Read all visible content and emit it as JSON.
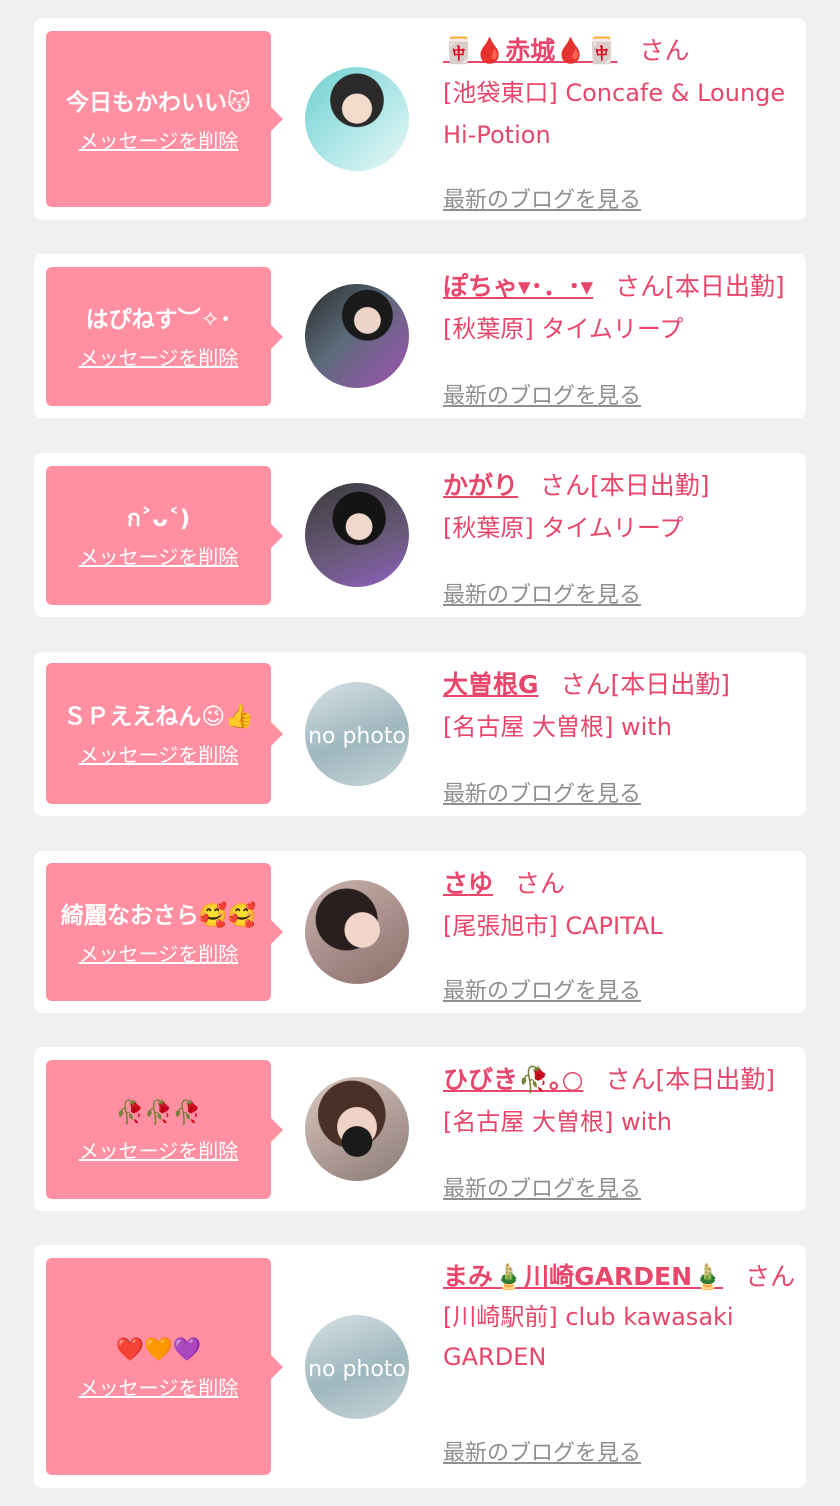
{
  "common": {
    "delete_label": "メッセージを削除",
    "blog_label": "最新のブログを見る",
    "no_photo": "no photo"
  },
  "items": [
    {
      "message": "今日もかわいい😽",
      "name": "🀄🩸赤城🩸🀄",
      "suffix": "さん",
      "shop": "[池袋東口] Concafe & Lounge Hi-Potion",
      "avatar": "photo"
    },
    {
      "message": "はぴねす︶✧･",
      "name": "ぽちゃ▾･．･▾",
      "suffix": "さん[本日出勤]",
      "shop": "[秋葉原] タイムリープ",
      "avatar": "photo"
    },
    {
      "message": "ก˃ᴗ˂)",
      "name": "かがり",
      "suffix": "さん[本日出勤]",
      "shop": "[秋葉原] タイムリープ",
      "avatar": "photo"
    },
    {
      "message": "ＳＰええねん😉👍",
      "name": "大曽根G",
      "suffix": "さん[本日出勤]",
      "shop": "[名古屋 大曽根] with",
      "avatar": "no-photo"
    },
    {
      "message": "綺麗なおさら🥰🥰",
      "name": "さゆ",
      "suffix": "さん",
      "shop": "[尾張旭市] CAPITAL",
      "avatar": "photo"
    },
    {
      "message": "🥀🥀🥀",
      "name": "ひびき🥀｡○",
      "suffix": "さん[本日出勤]",
      "shop": "[名古屋 大曽根] with",
      "avatar": "photo"
    },
    {
      "message": "❤️🧡💜",
      "name": "まみ🎍川崎GARDEN🎍",
      "suffix": "さん",
      "shop": "[川崎駅前] club kawasaki GARDEN",
      "avatar": "no-photo"
    }
  ]
}
